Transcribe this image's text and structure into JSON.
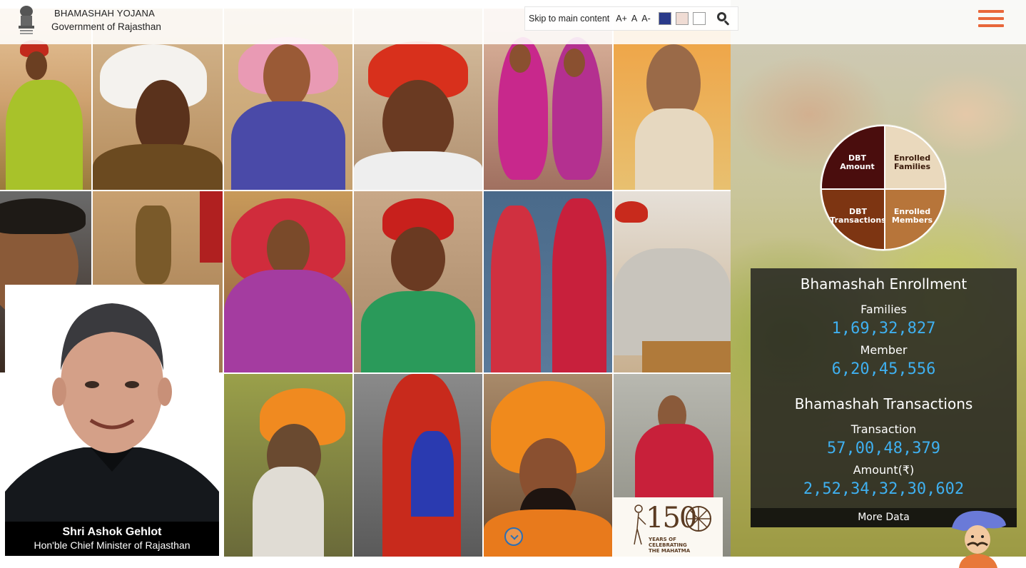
{
  "header": {
    "brand_title": "BHAMASHAH YOJANA",
    "brand_subtitle": "Government of Rajasthan",
    "skip_link": "Skip to main content",
    "font_increase": "A+",
    "font_normal": "A",
    "font_decrease": "A-",
    "theme_colors": [
      "#2a3a8a",
      "#f0dcd4",
      "#ffffff"
    ],
    "accent_color": "#e8673a"
  },
  "cm": {
    "name": "Shri Ashok Gehlot",
    "title": "Hon'ble Chief Minister of Rajasthan"
  },
  "pie_menu": {
    "dbt_amount": "DBT Amount",
    "enrolled_families": "Enrolled Families",
    "dbt_transactions": "DBT Transactions",
    "enrolled_members": "Enrolled Members"
  },
  "stats": {
    "enrollment_heading": "Bhamashah Enrollment",
    "families_label": "Families",
    "families_value": "1,69,32,827",
    "member_label": "Member",
    "member_value": "6,20,45,556",
    "transactions_heading": "Bhamashah Transactions",
    "transaction_label": "Transaction",
    "transaction_value": "57,00,48,379",
    "amount_label": "Amount(₹)",
    "amount_value": "2,52,34,32,30,602",
    "more_data": "More Data"
  },
  "badge": {
    "number": "150",
    "text_line1": "YEARS OF",
    "text_line2": "CELEBRATING",
    "text_line3": "THE MAHATMA"
  },
  "icons": {
    "search": "search-icon",
    "menu": "hamburger-menu-icon",
    "scroll": "scroll-down-icon",
    "emblem": "state-emblem-icon",
    "mascot": "mascot-icon"
  }
}
